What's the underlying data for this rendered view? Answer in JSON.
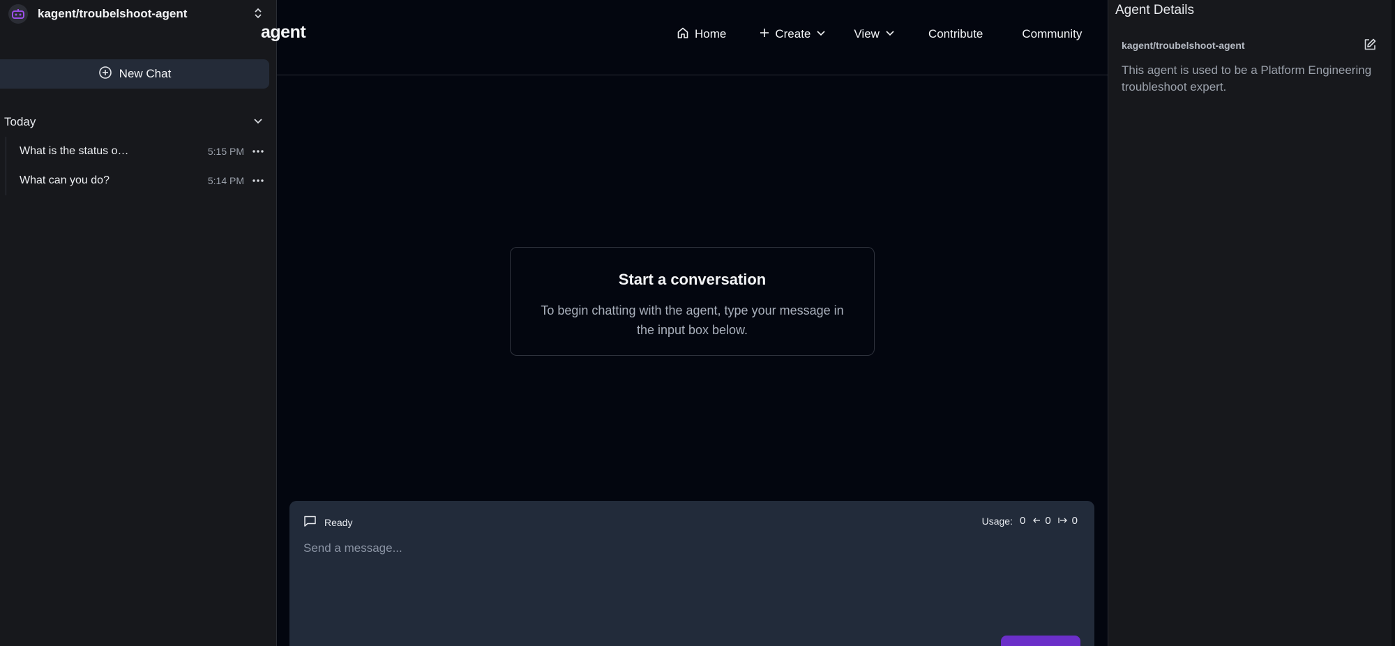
{
  "sidebar": {
    "agent_name": "kagent/troubelshoot-agent",
    "new_chat_label": "New Chat",
    "section_label": "Today",
    "history": [
      {
        "title": "What is the status o…",
        "time": "5:15 PM"
      },
      {
        "title": "What can you do?",
        "time": "5:14 PM"
      }
    ]
  },
  "header": {
    "brand": "agent",
    "nav": {
      "home": "Home",
      "create": "Create",
      "view": "View",
      "contribute": "Contribute",
      "community": "Community"
    }
  },
  "main": {
    "card_title": "Start a conversation",
    "card_body": "To begin chatting with the agent, type your message in the input box below."
  },
  "chat": {
    "status": "Ready",
    "usage_label": "Usage:",
    "usage_total": "0",
    "usage_in": "0",
    "usage_out": "0",
    "placeholder": "Send a message..."
  },
  "details": {
    "title": "Agent Details",
    "agent_name": "kagent/troubelshoot-agent",
    "description": "This agent is used to be a Platform Engineering troubleshoot expert."
  },
  "colors": {
    "background": "#03060f",
    "sidebar": "#17181c",
    "panel": "#222b3a",
    "accent": "#6b2fc9",
    "avatar_icon": "#9b4fe8"
  },
  "icons": {
    "avatar": "robot-icon",
    "switcher": "chevrons-up-down-icon",
    "new_chat": "plus-circle-icon",
    "section": "chevron-down-icon",
    "history_menu": "more-horizontal-icon",
    "home": "home-icon",
    "create": "plus-icon",
    "status": "message-square-icon",
    "edit": "edit-icon"
  }
}
